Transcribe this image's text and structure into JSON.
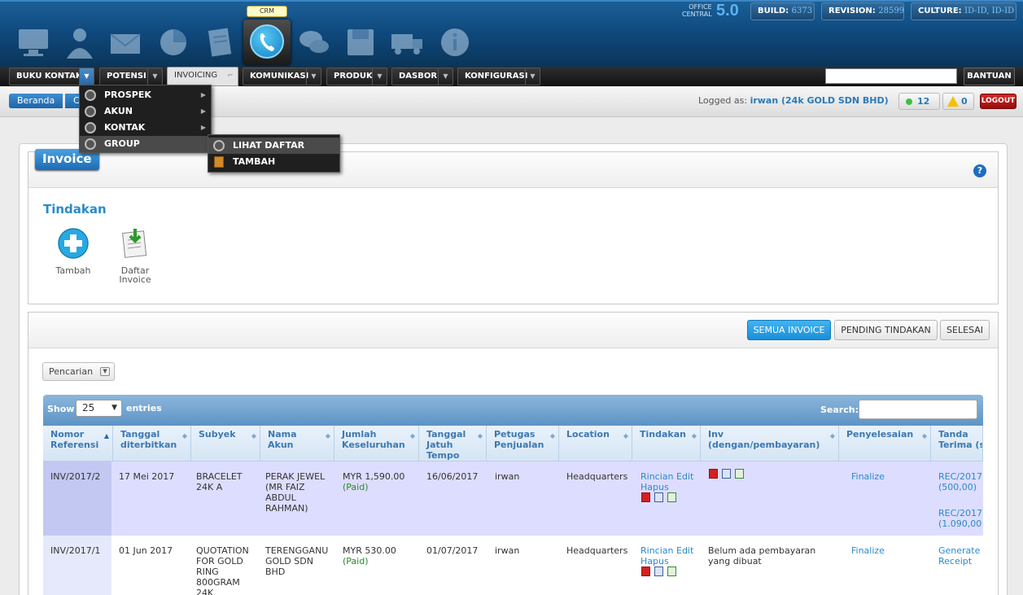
{
  "header": {
    "crm_tooltip": "CRM",
    "office_line1": "OFFICE",
    "office_line2": "CENTRAL",
    "version": "5.0",
    "build_label": "BUILD:",
    "build_value": "6373",
    "revision_label": "REVISION:",
    "revision_value": "28599",
    "culture_label": "CULTURE:",
    "culture_value": "ID-ID, ID-ID"
  },
  "menu": {
    "items": [
      "BUKU KONTAK",
      "POTENSI",
      "INVOICING",
      "KOMUNIKASI",
      "PRODUK",
      "DASBOR",
      "KONFIGURASI"
    ],
    "bantuan": "BANTUAN"
  },
  "dropdown": {
    "items": [
      "PROSPEK",
      "AKUN",
      "KONTAK",
      "GROUP"
    ],
    "submenu": [
      "LIHAT DAFTAR",
      "TAMBAH"
    ]
  },
  "subbar": {
    "breadcrumb_home": "Beranda",
    "breadcrumb_next": "C",
    "logged_prefix": "Logged as:",
    "logged_user": "irwan (24k GOLD SDN BHD)",
    "online_count": "12",
    "warning_count": "0",
    "logout": "LOGOUT"
  },
  "page": {
    "title": "Invoice",
    "help": "?",
    "tindakan": "Tindakan",
    "action_add": "Tambah",
    "action_list_1": "Daftar",
    "action_list_2": "Invoice"
  },
  "filters": {
    "all": "SEMUA INVOICE",
    "pending": "PENDING TINDAKAN",
    "done": "SELESAI",
    "pencarian": "Pencarian"
  },
  "table": {
    "show": "Show",
    "length": "25",
    "entries": "entries",
    "search": "Search:",
    "columns": [
      [
        "Nomor",
        "Referensi"
      ],
      [
        "Tanggal",
        "diterbitkan"
      ],
      [
        "Subyek",
        ""
      ],
      [
        "Nama",
        "Akun"
      ],
      [
        "Jumlah",
        "Keseluruhan"
      ],
      [
        "Tanggal",
        "Jatuh",
        "Tempo"
      ],
      [
        "Petugas",
        "Penjualan"
      ],
      [
        "Location",
        ""
      ],
      [
        "Tindakan",
        ""
      ],
      [
        "Inv",
        "(dengan/pembayaran)"
      ],
      [
        "Penyelesaian",
        ""
      ],
      [
        "Tanda",
        "Terima (s)"
      ]
    ],
    "rows": [
      {
        "ref": "INV/2017/2",
        "date": "17 Mei 2017",
        "subject": [
          "BRACELET",
          "24K A"
        ],
        "account": [
          "PERAK JEWEL",
          "(MR FAIZ",
          "ABDUL",
          "RAHMAN)"
        ],
        "amount": "MYR 1,590.00",
        "status": "(Paid)",
        "due": "16/06/2017",
        "sales": "irwan",
        "location": "Headquarters",
        "actions": [
          "Rincian",
          "Edit",
          "Hapus"
        ],
        "inv_note": "",
        "finalize": "Finalize",
        "receipts": [
          "REC/2017",
          "(500,00)",
          "REC/2017",
          "(1.090,00"
        ]
      },
      {
        "ref": "INV/2017/1",
        "date": "01 Jun 2017",
        "subject": [
          "QUOTATION",
          "FOR GOLD",
          "RING",
          "800GRAM",
          "24K"
        ],
        "account": [
          "TERENGGANU",
          "GOLD SDN",
          "BHD"
        ],
        "amount": "MYR 530.00",
        "status": "(Paid)",
        "due": "01/07/2017",
        "sales": "irwan",
        "location": "Headquarters",
        "actions": [
          "Rincian",
          "Edit",
          "Hapus"
        ],
        "inv_note": [
          "Belum ada pembayaran",
          "yang dibuat"
        ],
        "finalize": "Finalize",
        "receipts": [
          "Generate",
          "Receipt"
        ]
      }
    ]
  }
}
